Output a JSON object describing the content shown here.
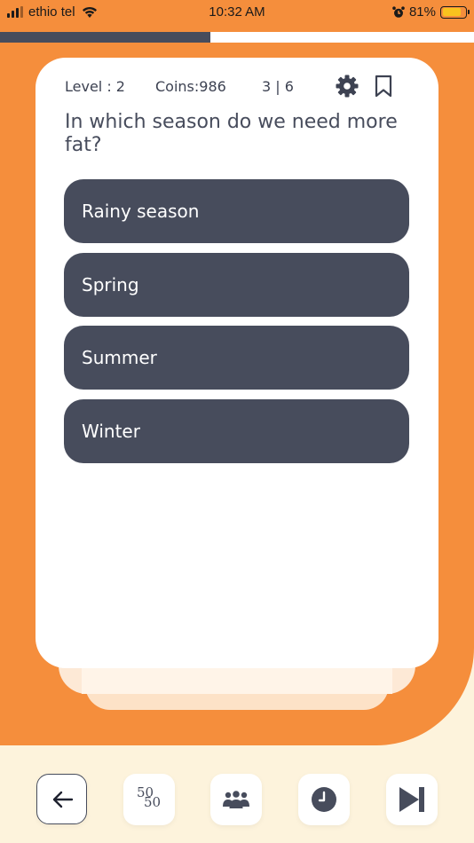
{
  "status_bar": {
    "carrier": "ethio tel",
    "time": "10:32 AM",
    "battery": "81%",
    "battery_level": 0.81
  },
  "progress": {
    "value": 0.444
  },
  "header": {
    "level": "Level : 2",
    "coins": "Coins:986",
    "counter": "3 | 6"
  },
  "question": {
    "text": "In which season do we need more fat?"
  },
  "options": [
    {
      "label": "Rainy season"
    },
    {
      "label": "Spring"
    },
    {
      "label": "Summer"
    },
    {
      "label": "Winter"
    }
  ],
  "toolbar": {
    "fifty_fifty": {
      "top": "50",
      "bottom": "50"
    }
  },
  "colors": {
    "accent_orange": "#f58e3c",
    "option_slate": "#474c5c",
    "page_cream": "#fdf3dc",
    "card_white": "#ffffff"
  },
  "icons": [
    "signal-icon",
    "wifi-icon",
    "alarm-icon",
    "battery-icon",
    "gear-icon",
    "bookmark-icon",
    "arrow-left-icon",
    "fifty-fifty-icon",
    "audience-icon",
    "clock-icon",
    "skip-icon"
  ]
}
